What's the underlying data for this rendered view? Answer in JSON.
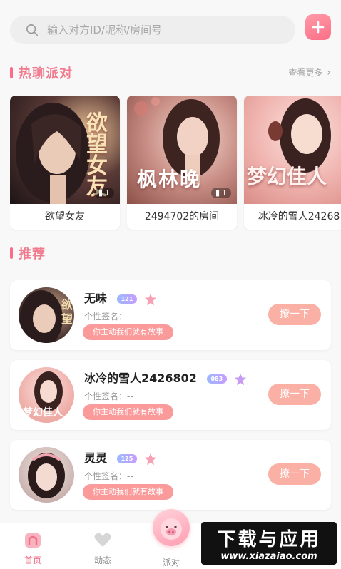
{
  "search": {
    "placeholder": "输入对方ID/昵称/房间号"
  },
  "hot_party": {
    "title": "热聊派对",
    "more": "查看更多",
    "cards": [
      {
        "name": "欲望女友",
        "cover_text": "欲望女友",
        "count": "1"
      },
      {
        "name": "2494702的房间",
        "cover_text": "枫林晚",
        "count": "1"
      },
      {
        "name": "冰冷的雪人24268",
        "cover_text": "梦幻佳人",
        "count": ""
      }
    ]
  },
  "recommend": {
    "title": "推荐",
    "items": [
      {
        "name": "无味",
        "level": "121",
        "signature": "个性签名：--",
        "tag": "你主动我们就有故事",
        "action": "撩一下"
      },
      {
        "name": "冰冷的雪人2426802",
        "level": "083",
        "signature": "个性签名：--",
        "tag": "你主动我们就有故事",
        "action": "撩一下"
      },
      {
        "name": "灵灵",
        "level": "125",
        "signature": "个性签名：--",
        "tag": "你主动我们就有故事",
        "action": "撩一下"
      }
    ]
  },
  "tabbar": {
    "items": [
      {
        "label": "首页"
      },
      {
        "label": "动态"
      },
      {
        "label": "派对"
      }
    ]
  },
  "watermark": {
    "line1": "下载与应用",
    "line2": "www.xiazaiao.com"
  },
  "colors": {
    "accent": "#f26d86",
    "button": "#fbb0a5",
    "tag": "#fb9a9a"
  }
}
